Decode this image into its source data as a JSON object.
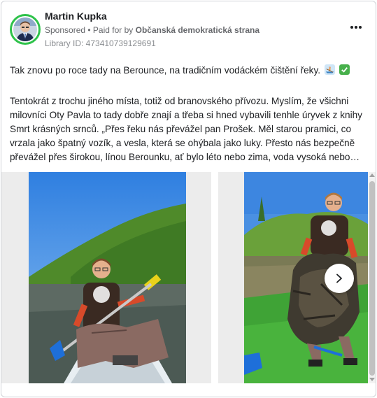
{
  "post": {
    "author": "Martin Kupka",
    "sponsored": "Sponsored",
    "paid_for_prefix": "• Paid for by",
    "paid_for_by": "Občanská demokratická strana",
    "library_id": "Library ID: 473410739129691",
    "paragraph1": "Tak znovu po roce tady na Berounce, na tradičním vodáckém čištění řeky.",
    "paragraph2_lines": [
      "Tentokrát z trochu jiného místa, totiž od branovského přívozu. Myslím, že všichni",
      "milovníci Oty Pavla to tady dobře znají a třeba si hned vybavili tenhle úryvek z knihy",
      "Smrt krásných srnců. „Přes řeku nás převážel pan Prošek. Měl starou pramici, co",
      "vrzala jako špatný vozík, a vesla, která se ohýbala jako luky. Přesto nás bezpečně",
      "převážel přes širokou, línou Berounku, ať bylo léto nebo zima, voda vysoká nebo…"
    ],
    "emoji_icons": [
      "rowboat-icon",
      "check-mark-icon"
    ]
  },
  "colors": {
    "avatar_ring": "#2ec24a",
    "check_emoji": "#47b04b",
    "text_muted": "#65676b"
  }
}
